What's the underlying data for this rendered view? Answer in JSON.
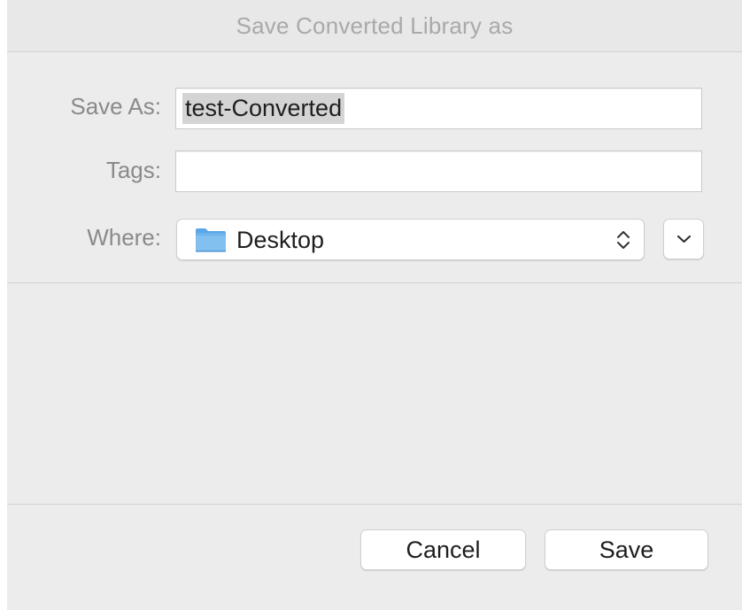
{
  "dialog": {
    "title": "Save Converted Library as"
  },
  "save_as": {
    "label": "Save As:",
    "value": "test-Converted"
  },
  "tags": {
    "label": "Tags:",
    "value": ""
  },
  "where": {
    "label": "Where:",
    "location": "Desktop",
    "icon": "folder-icon",
    "folder_color": "#5aa6e6"
  },
  "buttons": {
    "cancel_label": "Cancel",
    "save_label": "Save"
  }
}
